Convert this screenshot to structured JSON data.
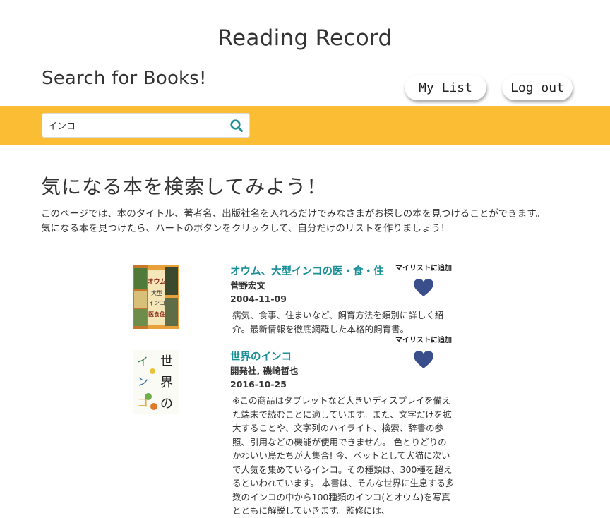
{
  "header": {
    "app_title": "Reading Record",
    "page_subtitle": "Search for Books!",
    "my_list_label": "My List",
    "logout_label": "Log out"
  },
  "search": {
    "value": "インコ",
    "accent_color": "#fbbd34",
    "icon_color": "#1a8f96"
  },
  "main": {
    "heading": "気になる本を検索してみよう！",
    "intro_line1": "このページでは、本のタイトル、著者名、出版社名を入れるだけでみなさまがお探しの本を見つけることができます。",
    "intro_line2": "気になる本を見つけたら、ハートのボタンをクリックして、自分だけのリストを作りましょう！"
  },
  "books": [
    {
      "title": "オウム、大型インコの医・食・住",
      "author": "菅野宏文",
      "date": "2004-11-09",
      "description": "病気、食事、住まいなど、飼育方法を類別に詳しく紹介。最新情報を徹底網羅した本格的飼育書。",
      "fav_label": "マイリストに追加",
      "cover_text": "オウム大型インコの医食住"
    },
    {
      "title": "世界のインコ",
      "author": "開発社, 磯崎哲也",
      "date": "2016-10-25",
      "description": "※この商品はタブレットなど大きいディスプレイを備えた端末で読むことに適しています。また、文字だけを拡大することや、文字列のハイライト、検索、辞書の参照、引用などの機能が使用できません。 色とりどりのかわいい鳥たちが大集合! 今、ペットとして犬猫に次いで人気を集めているインコ。その種類は、300種を超えるといわれています。 本書は、そんな世界に生息する多数のインコの中から100種類のインコ(とオウム)を写真とともに解説していきます。監修には、",
      "fav_label": "マイリストに追加",
      "cover_text": "世界のインコ"
    }
  ],
  "colors": {
    "link": "#1a8f96",
    "heart": "#3a4e8c",
    "divider": "#cccccc"
  }
}
